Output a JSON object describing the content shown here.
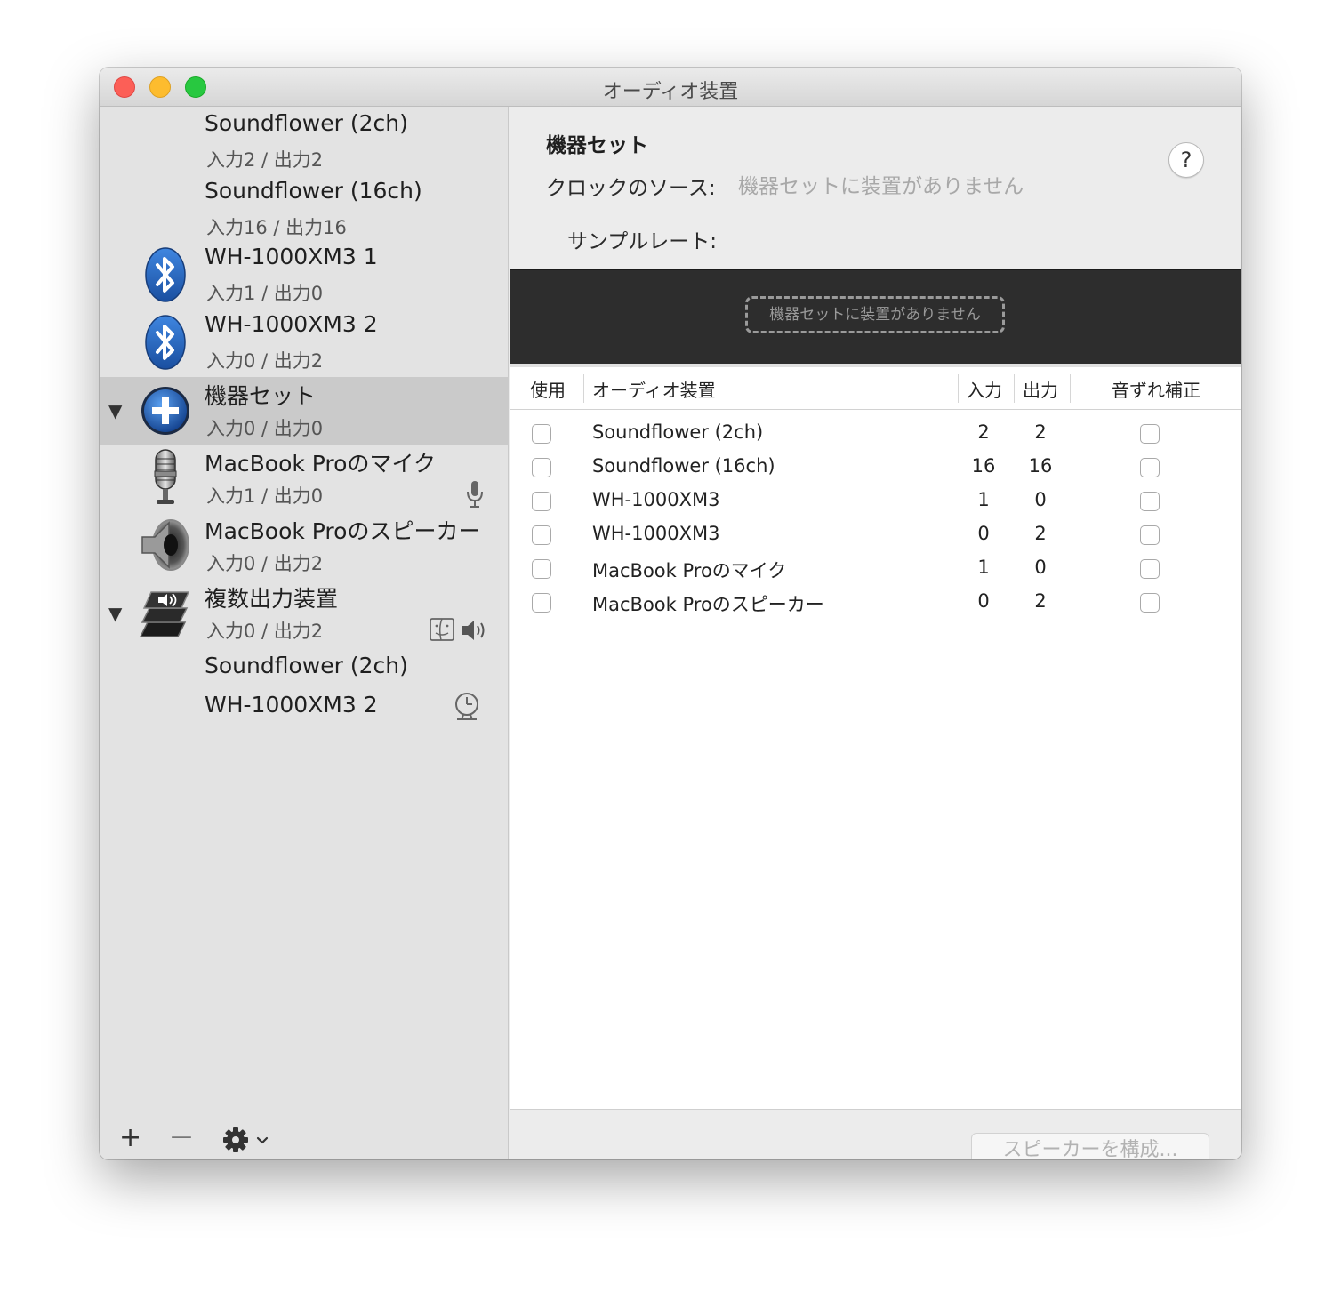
{
  "window": {
    "title": "オーディオ装置"
  },
  "sidebar": {
    "devices": [
      {
        "name": "Soundflower (2ch)",
        "io": "入力2 / 出力2",
        "icon": "none"
      },
      {
        "name": "Soundflower (16ch)",
        "io": "入力16 / 出力16",
        "icon": "none"
      },
      {
        "name": "WH-1000XM3 1",
        "io": "入力1 / 出力0",
        "icon": "bluetooth-icon"
      },
      {
        "name": "WH-1000XM3 2",
        "io": "入力0 / 出力2",
        "icon": "bluetooth-icon"
      },
      {
        "name": "機器セット",
        "io": "入力0 / 出力0",
        "icon": "aggregate-plus-icon",
        "selected": true
      },
      {
        "name": "MacBook Proのマイク",
        "io": "入力1 / 出力0",
        "icon": "microphone-icon"
      },
      {
        "name": "MacBook Proのスピーカー",
        "io": "入力0 / 出力2",
        "icon": "speaker-icon"
      },
      {
        "name": "複数出力装置",
        "io": "入力0 / 出力2",
        "icon": "multi-output-icon"
      }
    ],
    "multi_output_children": [
      {
        "name": "Soundflower (2ch)"
      },
      {
        "name": "WH-1000XM3 2"
      }
    ],
    "toolbar": {
      "add": "+",
      "remove": "—"
    }
  },
  "panel": {
    "title": "機器セット",
    "clock_label": "クロックのソース:",
    "clock_value": "機器セットに装置がありません",
    "sample_rate_label": "サンプルレート:",
    "help": "?",
    "empty_message": "機器セットに装置がありません",
    "table": {
      "headers": {
        "use": "使用",
        "device": "オーディオ装置",
        "input": "入力",
        "output": "出力",
        "drift": "音ずれ補正"
      },
      "rows": [
        {
          "name": "Soundflower (2ch)",
          "input": "2",
          "output": "2"
        },
        {
          "name": "Soundflower (16ch)",
          "input": "16",
          "output": "16"
        },
        {
          "name": "WH-1000XM3",
          "input": "1",
          "output": "0"
        },
        {
          "name": "WH-1000XM3",
          "input": "0",
          "output": "2"
        },
        {
          "name": "MacBook Proのマイク",
          "input": "1",
          "output": "0"
        },
        {
          "name": "MacBook Proのスピーカー",
          "input": "0",
          "output": "2"
        }
      ]
    },
    "configure_button": "スピーカーを構成..."
  },
  "colors": {
    "selection": "#cacaca",
    "sidebar": "#e3e3e3",
    "dark_strip": "#2d2d2d",
    "bluetooth": "#1f5fb8"
  }
}
